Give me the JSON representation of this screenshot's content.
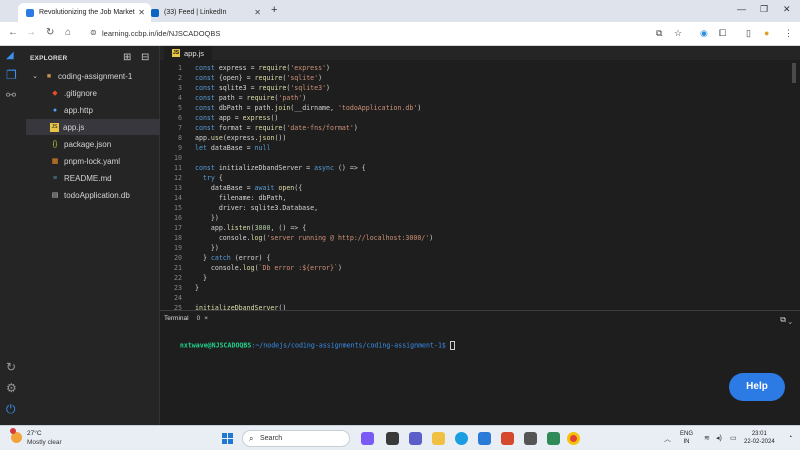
{
  "browser": {
    "tabs": [
      {
        "title": "Revolutionizing the Job Market"
      },
      {
        "title": "(33) Feed | LinkedIn"
      }
    ],
    "new_tab_glyph": "+",
    "url": "learning.ccbp.in/ide/NJSCADOQBS"
  },
  "explorer": {
    "title": "EXPLORER",
    "folder": "coding-assignment-1",
    "files": [
      {
        "name": ".gitignore",
        "icon": "git-icon"
      },
      {
        "name": "app.http",
        "icon": "http-icon"
      },
      {
        "name": "app.js",
        "icon": "js-icon",
        "selected": true
      },
      {
        "name": "package.json",
        "icon": "json-icon"
      },
      {
        "name": "pnpm-lock.yaml",
        "icon": "yaml-icon"
      },
      {
        "name": "README.md",
        "icon": "markdown-icon"
      },
      {
        "name": "todoApplication.db",
        "icon": "file-icon"
      }
    ]
  },
  "editor": {
    "tab_label": "app.js",
    "tab_badge": "JS",
    "lines": [
      {
        "n": "1",
        "code": "const express = require('express')"
      },
      {
        "n": "2",
        "code": "const {open} = require('sqlite')"
      },
      {
        "n": "3",
        "code": "const sqlite3 = require('sqlite3')"
      },
      {
        "n": "4",
        "code": "const path = require('path')"
      },
      {
        "n": "5",
        "code": "const dbPath = path.join(__dirname, 'todoApplication.db')"
      },
      {
        "n": "6",
        "code": "const app = express()"
      },
      {
        "n": "7",
        "code": "const format = require('date-fns/format')"
      },
      {
        "n": "8",
        "code": "app.use(express.json())"
      },
      {
        "n": "9",
        "code": "let dataBase = null"
      },
      {
        "n": "10",
        "code": ""
      },
      {
        "n": "11",
        "code": "const initializeDbandServer = async () => {"
      },
      {
        "n": "12",
        "code": "  try {"
      },
      {
        "n": "13",
        "code": "    dataBase = await open({"
      },
      {
        "n": "14",
        "code": "      filename: dbPath,"
      },
      {
        "n": "15",
        "code": "      driver: sqlite3.Database,"
      },
      {
        "n": "16",
        "code": "    })"
      },
      {
        "n": "17",
        "code": "    app.listen(3000, () => {"
      },
      {
        "n": "18",
        "code": "      console.log('server running @ http://localhost:3000/')"
      },
      {
        "n": "19",
        "code": "    })"
      },
      {
        "n": "20",
        "code": "  } catch (error) {"
      },
      {
        "n": "21",
        "code": "    console.log(`Db error :${error}`)"
      },
      {
        "n": "22",
        "code": "  }"
      },
      {
        "n": "23",
        "code": "}"
      },
      {
        "n": "24",
        "code": ""
      },
      {
        "n": "25",
        "code": "initializeDbandServer()"
      }
    ]
  },
  "terminal": {
    "title": "Terminal",
    "count": "0",
    "close_glyph": "×",
    "prompt_user": "nxtwave@NJSCADOQBS",
    "prompt_path": ":~/nodejs/coding-assignments/coding-assignment-1$"
  },
  "help_button": "Help",
  "taskbar": {
    "temperature": "27°C",
    "condition": "Mostly clear",
    "search_placeholder": "Search",
    "lang_line1": "ENG",
    "lang_line2": "IN",
    "time": "23:01",
    "date": "22-02-2024"
  }
}
